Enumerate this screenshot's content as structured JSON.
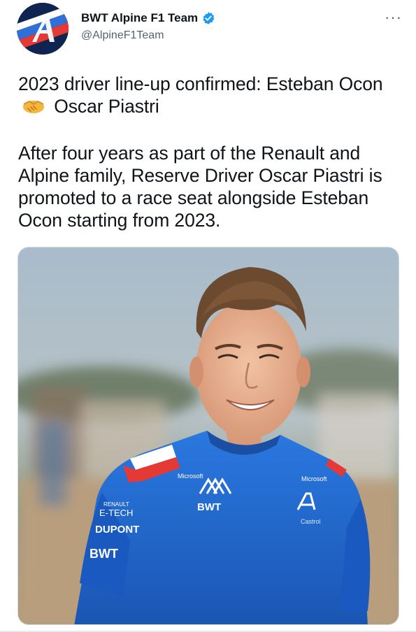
{
  "tweet": {
    "author_name": "BWT Alpine F1 Team",
    "author_handle": "@AlpineF1Team",
    "verified": true,
    "more_icon": "more-dots-icon",
    "paragraph1_before": "2023 driver line-up confirmed: Esteban Ocon",
    "paragraph1_emoji": "handshake-icon",
    "paragraph1_after": "Oscar Piastri",
    "paragraph2": "After four years as part of the Renault and Alpine family, Reserve Driver Oscar Piastri is promoted to a race seat alongside Esteban Ocon starting from 2023.",
    "shirt_texts": {
      "kappa": "BWT",
      "left_lines": [
        "RENAULT",
        "E-TECH",
        "DUPONT",
        "BWT"
      ],
      "sponsor_small_left": "Microsoft",
      "sponsor_small_right": "Microsoft",
      "right_small": "Castrol"
    }
  },
  "colors": {
    "accent_blue": "#1d9bf0",
    "text_primary": "#0f1419",
    "text_secondary": "#536471",
    "alpine_blue": "#1565c0",
    "alpine_navy": "#132a5a",
    "alpine_red": "#e53935"
  }
}
